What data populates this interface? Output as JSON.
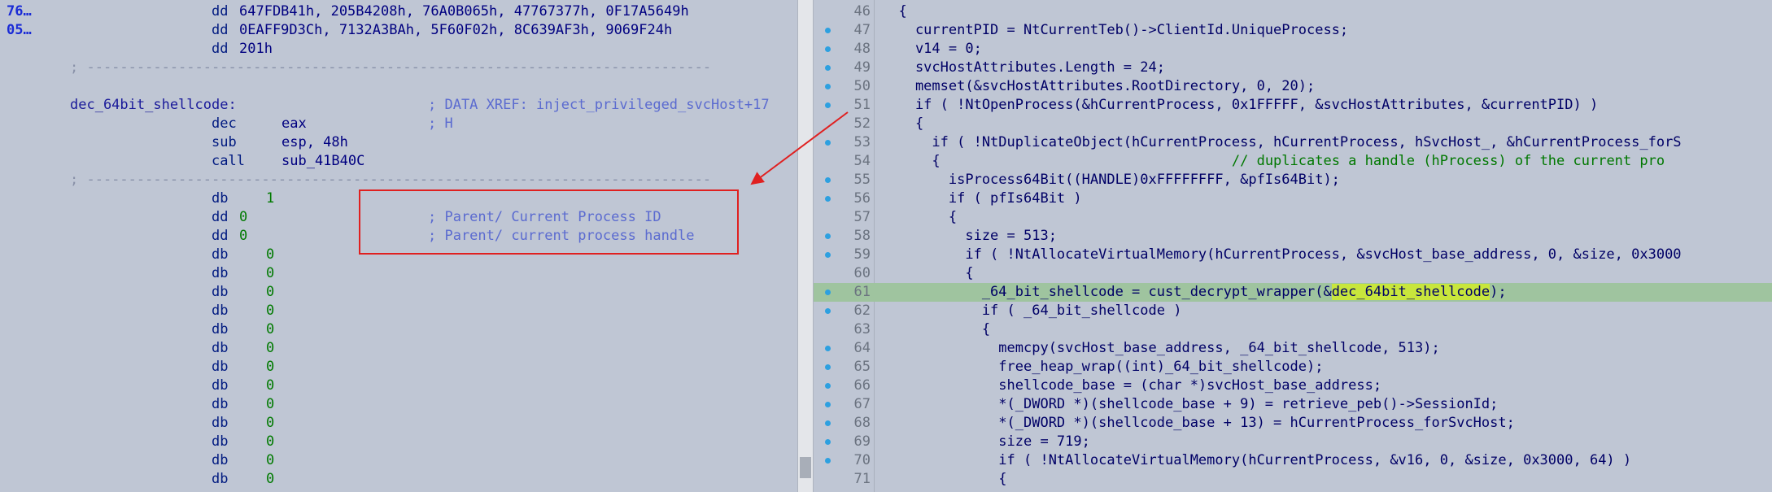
{
  "left": {
    "lines": [
      {
        "addr": "76…",
        "mn": "dd",
        "op": "647FDB41h, 205B4208h, 76A0B065h, 47767377h, 0F17A5649h"
      },
      {
        "addr": "05…",
        "mn": "dd",
        "op": "0EAFF9D3Ch, 7132A3BAh, 5F60F02h, 8C639AF3h, 9069F24h"
      },
      {
        "mn": "dd",
        "op": "201h"
      },
      {
        "dash": "; ---------------------------------------------------------------------------"
      },
      {},
      {
        "label": "dec_64bit_shellcode:",
        "cmt": "; DATA XREF: inject_privileged_svcHost+17"
      },
      {
        "mn": "dec",
        "op": "eax",
        "cmt": "; H"
      },
      {
        "mn": "sub",
        "op": "esp, 48h"
      },
      {
        "mn": "call",
        "op": "sub_41B40C"
      },
      {
        "dash": "; ---------------------------------------------------------------------------"
      },
      {
        "mn": "db",
        "op": "1"
      },
      {
        "mn": "dd",
        "op": "0",
        "cmt": "; Parent/ Current Process ID"
      },
      {
        "mn": "dd",
        "op": "0",
        "cmt": "; Parent/ current process handle"
      },
      {
        "mn": "db",
        "op": "0"
      },
      {
        "mn": "db",
        "op": "0"
      },
      {
        "mn": "db",
        "op": "0"
      },
      {
        "mn": "db",
        "op": "0"
      },
      {
        "mn": "db",
        "op": "0"
      },
      {
        "mn": "db",
        "op": "0"
      },
      {
        "mn": "db",
        "op": "0"
      },
      {
        "mn": "db",
        "op": "0"
      },
      {
        "mn": "db",
        "op": "0"
      },
      {
        "mn": "db",
        "op": "0"
      },
      {
        "mn": "db",
        "op": "0"
      },
      {
        "mn": "db",
        "op": "0"
      },
      {
        "mn": "db",
        "op": "0"
      }
    ]
  },
  "right": {
    "highlight_line": 61,
    "lines": [
      {
        "n": "46",
        "dot": false,
        "code": "  {"
      },
      {
        "n": "47",
        "dot": true,
        "code": "    currentPID = NtCurrentTeb()->ClientId.UniqueProcess;"
      },
      {
        "n": "48",
        "dot": true,
        "code": "    v14 = 0;"
      },
      {
        "n": "49",
        "dot": true,
        "code": "    svcHostAttributes.Length = 24;"
      },
      {
        "n": "50",
        "dot": true,
        "code": "    memset(&svcHostAttributes.RootDirectory, 0, 20);"
      },
      {
        "n": "51",
        "dot": true,
        "code": "    if ( !NtOpenProcess(&hCurrentProcess, 0x1FFFFF, &svcHostAttributes, &currentPID) )"
      },
      {
        "n": "52",
        "dot": false,
        "code": "    {"
      },
      {
        "n": "53",
        "dot": true,
        "code": "      if ( !NtDuplicateObject(hCurrentProcess, hCurrentProcess, hSvcHost_, &hCurrentProcess_forS"
      },
      {
        "n": "54",
        "dot": false,
        "code": "      {                                   // duplicates a handle (hProcess) of the current pro"
      },
      {
        "n": "55",
        "dot": true,
        "code": "        isProcess64Bit((HANDLE)0xFFFFFFFF, &pfIs64Bit);"
      },
      {
        "n": "56",
        "dot": true,
        "code": "        if ( pfIs64Bit )"
      },
      {
        "n": "57",
        "dot": false,
        "code": "        {"
      },
      {
        "n": "58",
        "dot": true,
        "code": "          size = 513;"
      },
      {
        "n": "59",
        "dot": true,
        "code": "          if ( !NtAllocateVirtualMemory(hCurrentProcess, &svcHost_base_address, 0, &size, 0x3000"
      },
      {
        "n": "60",
        "dot": false,
        "code": "          {"
      },
      {
        "n": "61",
        "dot": true,
        "code": "            _64_bit_shellcode = cust_decrypt_wrapper(&dec_64bit_shellcode);"
      },
      {
        "n": "62",
        "dot": true,
        "code": "            if ( _64_bit_shellcode )"
      },
      {
        "n": "63",
        "dot": false,
        "code": "            {"
      },
      {
        "n": "64",
        "dot": true,
        "code": "              memcpy(svcHost_base_address, _64_bit_shellcode, 513);"
      },
      {
        "n": "65",
        "dot": true,
        "code": "              free_heap_wrap((int)_64_bit_shellcode);"
      },
      {
        "n": "66",
        "dot": true,
        "code": "              shellcode_base = (char *)svcHost_base_address;"
      },
      {
        "n": "67",
        "dot": true,
        "code": "              *(_DWORD *)(shellcode_base + 9) = retrieve_peb()->SessionId;"
      },
      {
        "n": "68",
        "dot": true,
        "code": "              *(_DWORD *)(shellcode_base + 13) = hCurrentProcess_forSvcHost;"
      },
      {
        "n": "69",
        "dot": true,
        "code": "              size = 719;"
      },
      {
        "n": "70",
        "dot": true,
        "code": "              if ( !NtAllocateVirtualMemory(hCurrentProcess, &v16, 0, &size, 0x3000, 64) )"
      },
      {
        "n": "71",
        "dot": false,
        "code": "              {"
      }
    ]
  },
  "colors": {
    "background": "#bfc6d4",
    "highlight_row": "#9fc49f",
    "highlight_word": "#c8e63c",
    "annotation": "#e02020",
    "breakpoint_dot": "#2da0e0"
  }
}
